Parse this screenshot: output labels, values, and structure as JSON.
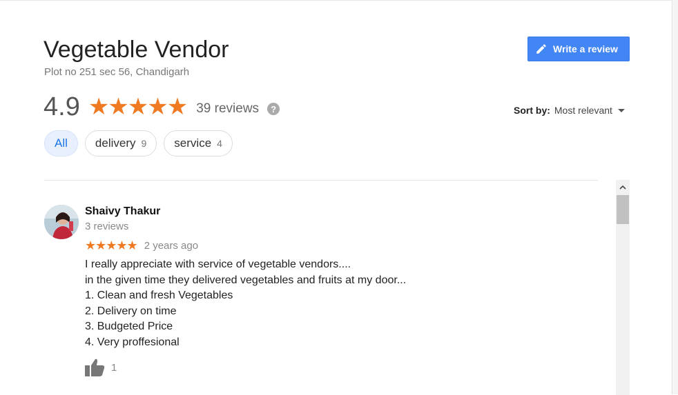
{
  "place": {
    "name": "Vegetable Vendor",
    "address": "Plot no 251 sec 56, Chandigarh"
  },
  "write_review": {
    "label": "Write a review",
    "icon": "pencil-icon"
  },
  "rating": {
    "score": "4.9",
    "stars": "★★★★★",
    "reviews_label": "39 reviews",
    "help_icon": "?"
  },
  "sort": {
    "label": "Sort by:",
    "value": "Most relevant"
  },
  "filters": [
    {
      "label": "All",
      "count": ""
    },
    {
      "label": "delivery",
      "count": "9"
    },
    {
      "label": "service",
      "count": "4"
    }
  ],
  "review": {
    "author": "Shaivy Thakur",
    "author_reviews": "3 reviews",
    "stars": "★★★★★",
    "time": "2 years ago",
    "lines": [
      "I really appreciate with service of vegetable vendors....",
      "in the given time they delivered vegetables and fruits at my door...",
      "1. Clean and fresh Vegetables",
      "2. Delivery on time",
      "3. Budgeted Price",
      "4. Very proffesional"
    ],
    "likes": "1"
  },
  "colors": {
    "star": "#f07a22",
    "button": "#4285f4",
    "chip_active_bg": "#e8f0fe",
    "chip_active_text": "#1a73e8"
  }
}
